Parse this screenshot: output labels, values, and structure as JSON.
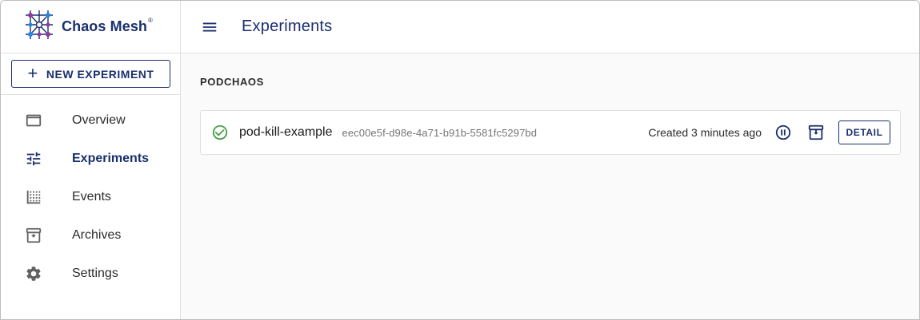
{
  "brand": {
    "name": "Chaos Mesh",
    "trademark": "®"
  },
  "sidebar": {
    "new_experiment_label": "NEW EXPERIMENT",
    "new_experiment_icon": "+",
    "items": [
      {
        "label": "Overview",
        "icon": "overview-icon",
        "active": false
      },
      {
        "label": "Experiments",
        "icon": "tune-icon",
        "active": true
      },
      {
        "label": "Events",
        "icon": "events-icon",
        "active": false
      },
      {
        "label": "Archives",
        "icon": "archive-icon",
        "active": false
      },
      {
        "label": "Settings",
        "icon": "gear-icon",
        "active": false
      }
    ]
  },
  "header": {
    "title": "Experiments",
    "menu_icon": "menu-icon"
  },
  "main": {
    "section_title": "PODCHAOS",
    "experiments": [
      {
        "status": "running",
        "status_icon": "check-circle-icon",
        "name": "pod-kill-example",
        "uid": "eec00e5f-d98e-4a71-b91b-5581fc5297bd",
        "created": "Created 3 minutes ago",
        "pause_icon": "pause-circle-icon",
        "archive_icon": "archive-icon",
        "detail_label": "DETAIL"
      }
    ]
  },
  "colors": {
    "brand": "#1a2f6e",
    "success": "#43a047",
    "text_secondary": "#757575",
    "border": "#e0e0e0",
    "background": "#fafafa"
  }
}
